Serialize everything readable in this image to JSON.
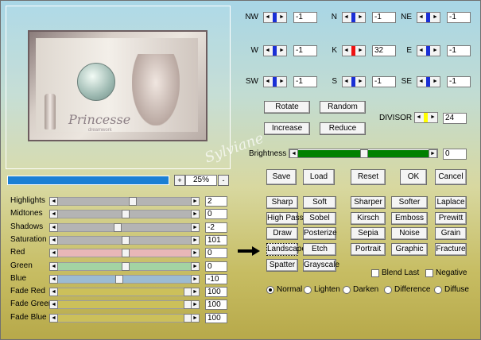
{
  "zoom": {
    "minus": "-",
    "plus": "+",
    "value": "25%"
  },
  "colors": {
    "progress": "#1b7fd4",
    "brightness": "#008000",
    "yellow": "#ffff00",
    "red": "#ee1111",
    "blue": "#1a2fd6"
  },
  "watermark": "Sylviane",
  "preview": {
    "title": "Princesse",
    "subtitle": "dreamwork"
  },
  "sliders": [
    {
      "label": "Highlights",
      "value": "2",
      "pos": 0.56,
      "color": "#b4b4b4"
    },
    {
      "label": "Midtones",
      "value": "0",
      "pos": 0.5,
      "color": "#b4b4b4"
    },
    {
      "label": "Shadows",
      "value": "-2",
      "pos": 0.44,
      "color": "#b4b4b4"
    },
    {
      "label": "Saturation",
      "value": "101",
      "pos": 0.5,
      "color": "#b4b4b4"
    },
    {
      "label": "Red",
      "value": "0",
      "pos": 0.5,
      "color": "#e8b7b7"
    },
    {
      "label": "Green",
      "value": "0",
      "pos": 0.5,
      "color": "#a3d3a3"
    },
    {
      "label": "Blue",
      "value": "-10",
      "pos": 0.45,
      "color": "#9cbbd2"
    },
    {
      "label": "Fade Red",
      "value": "100",
      "pos": 1.0,
      "color": "#ccc05a"
    },
    {
      "label": "Fade Green",
      "value": "100",
      "pos": 1.0,
      "color": "#ccc05a"
    },
    {
      "label": "Fade Blue",
      "value": "100",
      "pos": 1.0,
      "color": "#ccc05a"
    }
  ],
  "kernel": [
    [
      {
        "dir": "NW",
        "value": "-1"
      },
      {
        "dir": "N",
        "value": "-1"
      },
      {
        "dir": "NE",
        "value": "-1"
      }
    ],
    [
      {
        "dir": "W",
        "value": "-1"
      },
      {
        "dir": "K",
        "value": "32"
      },
      {
        "dir": "E",
        "value": "-1"
      }
    ],
    [
      {
        "dir": "SW",
        "value": "-1"
      },
      {
        "dir": "S",
        "value": "-1"
      },
      {
        "dir": "SE",
        "value": "-1"
      }
    ]
  ],
  "divisor": {
    "label": "DIVISOR",
    "value": "24"
  },
  "actions": {
    "rotate": "Rotate",
    "random": "Random",
    "increase": "Increase",
    "reduce": "Reduce"
  },
  "brightness": {
    "label": "Brightness",
    "value": "0",
    "pos": 0.5
  },
  "main_buttons": {
    "save": "Save",
    "load": "Load",
    "reset": "Reset",
    "ok": "OK",
    "cancel": "Cancel"
  },
  "presets": [
    [
      "Sharp",
      "Soft",
      "Sharper",
      "Softer",
      "Laplace"
    ],
    [
      "High Pass",
      "Sobel",
      "Kirsch",
      "Emboss",
      "Prewitt"
    ],
    [
      "Draw",
      "Posterize",
      "Sepia",
      "Noise",
      "Grain"
    ],
    [
      "Landscape",
      "Etch",
      "Portrait",
      "Graphic",
      "Fracture"
    ],
    [
      "Spatter",
      "Grayscale"
    ]
  ],
  "checkboxes": {
    "blend_last": "Blend Last",
    "negative": "Negative"
  },
  "modes": [
    "Normal",
    "Lighten",
    "Darken",
    "Difference",
    "Diffuse"
  ]
}
